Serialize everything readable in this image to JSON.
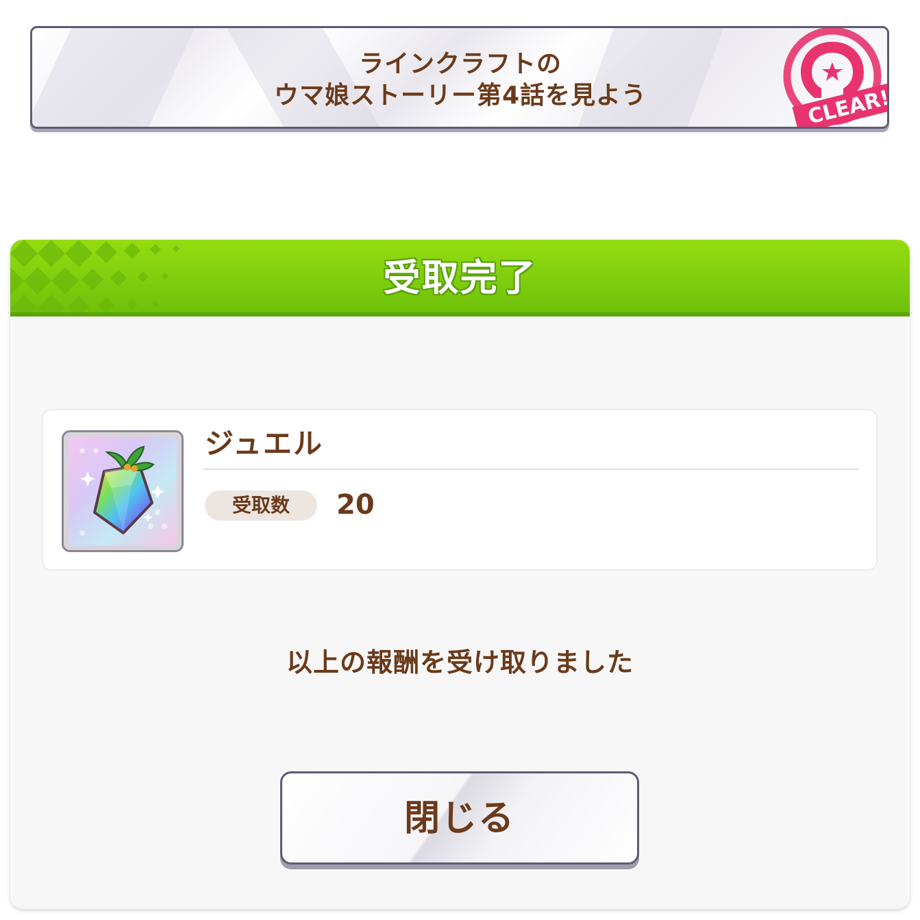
{
  "mission": {
    "title_line1": "ラインクラフトの",
    "title_line2": "ウマ娘ストーリー第4話を見よう",
    "stamp_text": "CLEAR!",
    "stamp_color": "#e8336f"
  },
  "dialog": {
    "title": "受取完了",
    "header_color": "#7ccc0e",
    "reward": {
      "icon": "jewel-icon",
      "name": "ジュエル",
      "quantity_label": "受取数",
      "quantity": "20"
    },
    "message": "以上の報酬を受け取りました",
    "close_label": "閉じる"
  },
  "colors": {
    "text_brown": "#6b3a1a",
    "frame_border": "#5e5a72"
  }
}
